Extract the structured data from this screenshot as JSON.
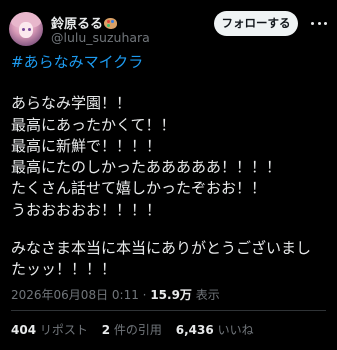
{
  "author": {
    "display_name": "鈴原るる",
    "handle": "@lulu_suzuhara",
    "name_icon": "artist-palette-icon"
  },
  "follow_button": {
    "label": "フォローする"
  },
  "more_icon": "more-horizontal-icon",
  "tweet": {
    "hashtag": "#あらなみマイクラ",
    "lines": [
      "あらなみ学園！！",
      "最高にあったかくて！！",
      "最高に新鮮で！！！！",
      "最高にたのしかったあああああ！！！！",
      "たくさん話せて嬉しかったぞおお！！",
      "うおおおおお！！！！",
      "みなさま本当に本当にありがとうございまし",
      "たッッ！！！！"
    ]
  },
  "meta": {
    "timestamp": "2026年06月08日 0:11",
    "separator": "·",
    "views_count": "15.9万",
    "views_label": "表示"
  },
  "stats": {
    "reposts_count": "404",
    "reposts_label": "リポスト",
    "quotes_count": "2",
    "quotes_label": "件の引用",
    "likes_count": "6,436",
    "likes_label": "いいね"
  },
  "colors": {
    "background": "#000000",
    "text": "#e7e9ea",
    "secondary": "#71767b",
    "link": "#1d9bf0",
    "button_bg": "#eff3f4"
  }
}
